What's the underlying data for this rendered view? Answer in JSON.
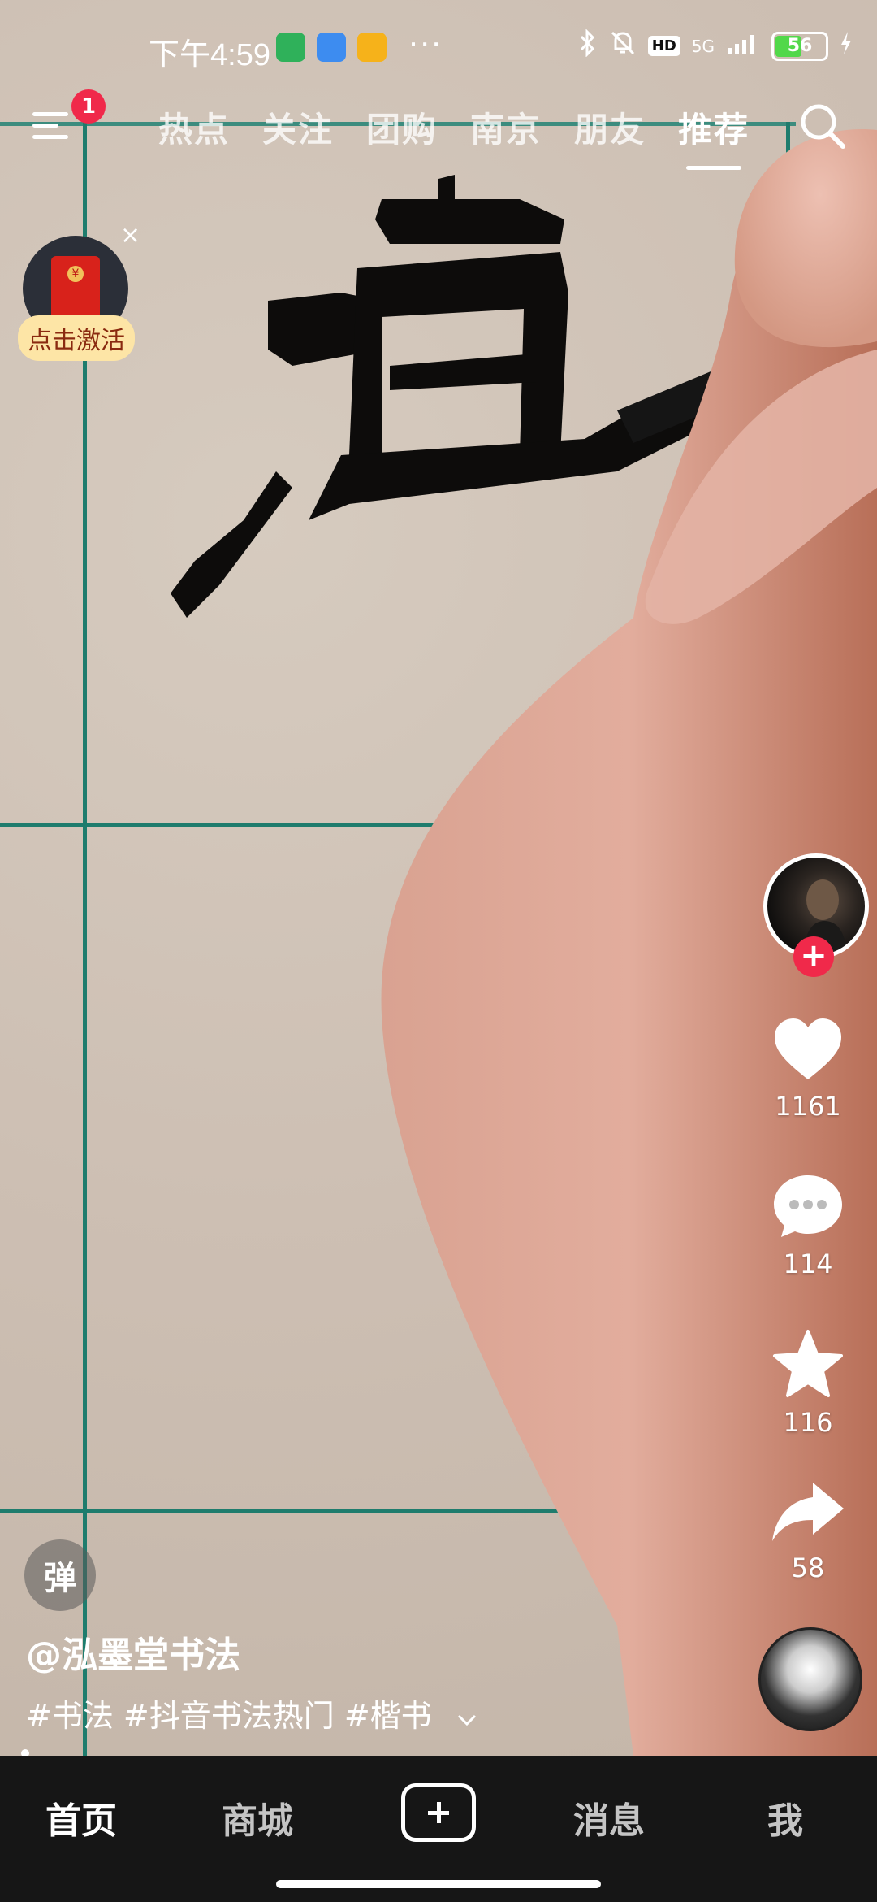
{
  "status_bar": {
    "time": "下午4:59",
    "network": "5G",
    "hd": "HD",
    "battery": "56",
    "battery_level": 0.56
  },
  "top_nav": {
    "badge": "1",
    "tabs": [
      "热点",
      "关注",
      "团购",
      "南京",
      "朋友",
      "推荐"
    ],
    "active_tab": "推荐"
  },
  "red_packet": {
    "label": "点击激活",
    "close": "×"
  },
  "video": {
    "danmu_label": "弹",
    "author": "@泓墨堂书法",
    "tags": "#书法 #抖音书法热门 #楷书"
  },
  "actions": {
    "likes": "1161",
    "comments": "114",
    "favorites": "116",
    "shares": "58"
  },
  "bottom_nav": {
    "home": "首页",
    "mall": "商城",
    "messages": "消息",
    "me": "我"
  },
  "colors": {
    "accent": "#f0294a",
    "grid": "#1e7c6d",
    "battery": "#52d84a"
  }
}
